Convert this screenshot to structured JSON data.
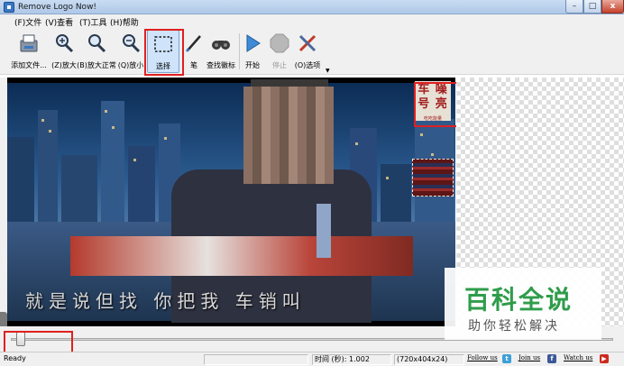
{
  "window": {
    "title": "Remove Logo Now!",
    "min": "–",
    "max": "□",
    "close": "x"
  },
  "menu": {
    "items": [
      "(F)文件",
      "(V)查看",
      "(T)工具",
      "(H)帮助"
    ]
  },
  "toolbar": {
    "items": [
      {
        "id": "add-file",
        "label": "添加文件...",
        "icon": "add-file-icon"
      },
      {
        "id": "zoom-in",
        "label": "(Z)放大",
        "icon": "zoom-in-icon"
      },
      {
        "id": "zoom-normal",
        "label": "(B)放大正常",
        "icon": "zoom-normal-icon"
      },
      {
        "id": "zoom-out",
        "label": "(Q)放小",
        "icon": "zoom-out-icon"
      },
      {
        "id": "select",
        "label": "选择",
        "icon": "select-icon",
        "active": true
      },
      {
        "id": "pen",
        "label": "笔",
        "icon": "pen-icon"
      },
      {
        "id": "find-logo",
        "label": "查找徽标",
        "icon": "binoculars-icon"
      },
      {
        "id": "start",
        "label": "开始",
        "icon": "play-icon"
      },
      {
        "id": "stop",
        "label": "停止",
        "icon": "stop-icon",
        "disabled": true
      },
      {
        "id": "options",
        "label": "(O)选项",
        "icon": "tools-icon"
      }
    ]
  },
  "video": {
    "logo_text": "车 噪\n号 亮",
    "logo_sub": "吃吃能量",
    "subtitle": "就是说但找   你把我   车销叫"
  },
  "status": {
    "ready": "Ready",
    "time": "时间 (秒): 1.002",
    "dimensions": "(720x404x24)",
    "follow": "Follow us",
    "join": "Join us",
    "watch": "Watch us"
  },
  "watermark": {
    "title": "百科全说",
    "sub": "助你轻松解决"
  },
  "colors": {
    "accent": "#3b78c2",
    "highlight": "#e02020",
    "watermark": "#2f9c4a"
  }
}
